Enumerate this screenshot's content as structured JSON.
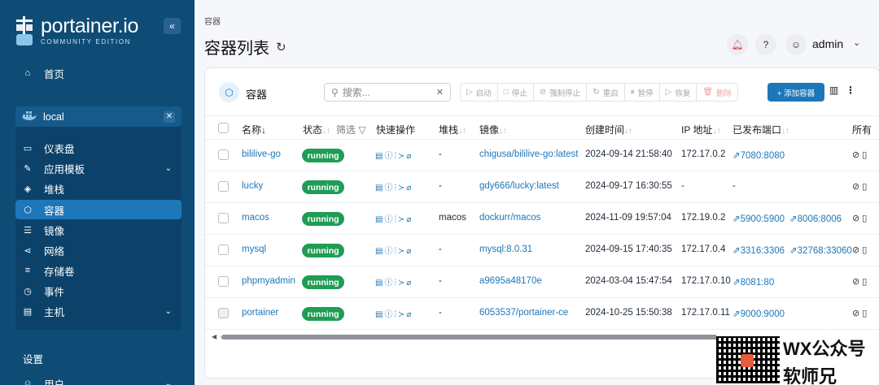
{
  "sidebar": {
    "logo_text": "portainer.io",
    "logo_sub": "COMMUNITY EDITION",
    "collapse_icon": "«",
    "home_label": "首页",
    "environment": "local",
    "items": [
      {
        "label": "仪表盘",
        "icon": "dashboard-icon"
      },
      {
        "label": "应用模板",
        "icon": "edit-icon",
        "expandable": true
      },
      {
        "label": "堆栈",
        "icon": "layers-icon"
      },
      {
        "label": "容器",
        "icon": "box-icon",
        "active": true
      },
      {
        "label": "镜像",
        "icon": "list-icon"
      },
      {
        "label": "网络",
        "icon": "network-icon"
      },
      {
        "label": "存储卷",
        "icon": "database-icon"
      },
      {
        "label": "事件",
        "icon": "clock-icon"
      },
      {
        "label": "主机",
        "icon": "host-icon",
        "expandable": true
      }
    ],
    "settings_label": "设置",
    "users_label": "用户"
  },
  "header": {
    "breadcrumb": "容器",
    "title": "容器列表",
    "user": "admin"
  },
  "card": {
    "title": "容器",
    "search_placeholder": "搜索...",
    "actions": [
      {
        "label": "启动",
        "icon": "▷"
      },
      {
        "label": "停止",
        "icon": "□"
      },
      {
        "label": "强制停止",
        "icon": "⊘"
      },
      {
        "label": "重启",
        "icon": "↻"
      },
      {
        "label": "暂停",
        "icon": "⏸"
      },
      {
        "label": "恢复",
        "icon": "▷"
      },
      {
        "label": "删除",
        "icon": "🗑"
      }
    ],
    "add_label": "+ 添加容器"
  },
  "table": {
    "columns": {
      "name": "名称↓",
      "state": "状态",
      "filter": "筛选",
      "quick_actions": "快速操作",
      "stack": "堆栈",
      "image": "镜像",
      "created": "创建时间",
      "ip": "IP 地址",
      "ports": "已发布端口",
      "owner": "所有"
    },
    "rows": [
      {
        "name": "bililive-go",
        "state": "running",
        "stack": "-",
        "image": "chigusa/bililive-go:latest",
        "created": "2024-09-14 21:58:40",
        "ip": "172.17.0.2",
        "ports": [
          "7080:8080"
        ]
      },
      {
        "name": "lucky",
        "state": "running",
        "stack": "-",
        "image": "gdy666/lucky:latest",
        "created": "2024-09-17 16:30:55",
        "ip": "-",
        "ports": [
          "-"
        ]
      },
      {
        "name": "macos",
        "state": "running",
        "stack": "macos",
        "image": "dockurr/macos",
        "created": "2024-11-09 19:57:04",
        "ip": "172.19.0.2",
        "ports": [
          "5900:5900",
          "8006:8006"
        ]
      },
      {
        "name": "mysql",
        "state": "running",
        "stack": "-",
        "image": "mysql:8.0.31",
        "created": "2024-09-15 17:40:35",
        "ip": "172.17.0.4",
        "ports": [
          "3316:3306",
          "32768:33060"
        ]
      },
      {
        "name": "phpmyadmin",
        "state": "running",
        "stack": "-",
        "image": "a9695a48170e",
        "created": "2024-03-04 15:47:54",
        "ip": "172.17.0.10",
        "ports": [
          "8081:80"
        ]
      },
      {
        "name": "portainer",
        "state": "running",
        "stack": "-",
        "image": "6053537/portainer-ce",
        "created": "2024-10-25 15:50:38",
        "ip": "172.17.0.11",
        "ports": [
          "9000:9000"
        ]
      }
    ]
  },
  "watermark": {
    "line1": "WX公众号",
    "line2": "软师兄"
  },
  "colors": {
    "sidebar": "#0f4c75",
    "accent": "#1d77b8",
    "running": "#1f9d55"
  }
}
